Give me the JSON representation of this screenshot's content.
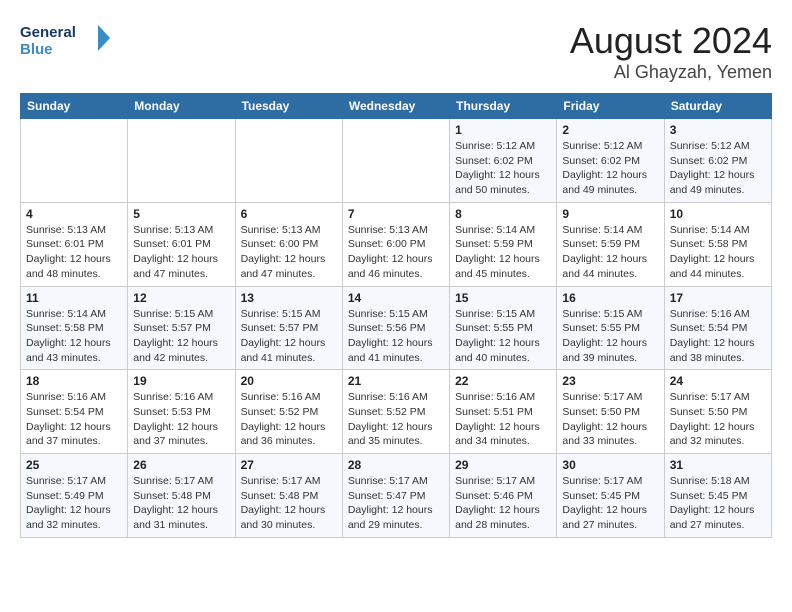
{
  "header": {
    "logo_general": "General",
    "logo_blue": "Blue",
    "month": "August 2024",
    "location": "Al Ghayzah, Yemen"
  },
  "weekdays": [
    "Sunday",
    "Monday",
    "Tuesday",
    "Wednesday",
    "Thursday",
    "Friday",
    "Saturday"
  ],
  "weeks": [
    [
      {
        "day": "",
        "info": ""
      },
      {
        "day": "",
        "info": ""
      },
      {
        "day": "",
        "info": ""
      },
      {
        "day": "",
        "info": ""
      },
      {
        "day": "1",
        "info": "Sunrise: 5:12 AM\nSunset: 6:02 PM\nDaylight: 12 hours\nand 50 minutes."
      },
      {
        "day": "2",
        "info": "Sunrise: 5:12 AM\nSunset: 6:02 PM\nDaylight: 12 hours\nand 49 minutes."
      },
      {
        "day": "3",
        "info": "Sunrise: 5:12 AM\nSunset: 6:02 PM\nDaylight: 12 hours\nand 49 minutes."
      }
    ],
    [
      {
        "day": "4",
        "info": "Sunrise: 5:13 AM\nSunset: 6:01 PM\nDaylight: 12 hours\nand 48 minutes."
      },
      {
        "day": "5",
        "info": "Sunrise: 5:13 AM\nSunset: 6:01 PM\nDaylight: 12 hours\nand 47 minutes."
      },
      {
        "day": "6",
        "info": "Sunrise: 5:13 AM\nSunset: 6:00 PM\nDaylight: 12 hours\nand 47 minutes."
      },
      {
        "day": "7",
        "info": "Sunrise: 5:13 AM\nSunset: 6:00 PM\nDaylight: 12 hours\nand 46 minutes."
      },
      {
        "day": "8",
        "info": "Sunrise: 5:14 AM\nSunset: 5:59 PM\nDaylight: 12 hours\nand 45 minutes."
      },
      {
        "day": "9",
        "info": "Sunrise: 5:14 AM\nSunset: 5:59 PM\nDaylight: 12 hours\nand 44 minutes."
      },
      {
        "day": "10",
        "info": "Sunrise: 5:14 AM\nSunset: 5:58 PM\nDaylight: 12 hours\nand 44 minutes."
      }
    ],
    [
      {
        "day": "11",
        "info": "Sunrise: 5:14 AM\nSunset: 5:58 PM\nDaylight: 12 hours\nand 43 minutes."
      },
      {
        "day": "12",
        "info": "Sunrise: 5:15 AM\nSunset: 5:57 PM\nDaylight: 12 hours\nand 42 minutes."
      },
      {
        "day": "13",
        "info": "Sunrise: 5:15 AM\nSunset: 5:57 PM\nDaylight: 12 hours\nand 41 minutes."
      },
      {
        "day": "14",
        "info": "Sunrise: 5:15 AM\nSunset: 5:56 PM\nDaylight: 12 hours\nand 41 minutes."
      },
      {
        "day": "15",
        "info": "Sunrise: 5:15 AM\nSunset: 5:55 PM\nDaylight: 12 hours\nand 40 minutes."
      },
      {
        "day": "16",
        "info": "Sunrise: 5:15 AM\nSunset: 5:55 PM\nDaylight: 12 hours\nand 39 minutes."
      },
      {
        "day": "17",
        "info": "Sunrise: 5:16 AM\nSunset: 5:54 PM\nDaylight: 12 hours\nand 38 minutes."
      }
    ],
    [
      {
        "day": "18",
        "info": "Sunrise: 5:16 AM\nSunset: 5:54 PM\nDaylight: 12 hours\nand 37 minutes."
      },
      {
        "day": "19",
        "info": "Sunrise: 5:16 AM\nSunset: 5:53 PM\nDaylight: 12 hours\nand 37 minutes."
      },
      {
        "day": "20",
        "info": "Sunrise: 5:16 AM\nSunset: 5:52 PM\nDaylight: 12 hours\nand 36 minutes."
      },
      {
        "day": "21",
        "info": "Sunrise: 5:16 AM\nSunset: 5:52 PM\nDaylight: 12 hours\nand 35 minutes."
      },
      {
        "day": "22",
        "info": "Sunrise: 5:16 AM\nSunset: 5:51 PM\nDaylight: 12 hours\nand 34 minutes."
      },
      {
        "day": "23",
        "info": "Sunrise: 5:17 AM\nSunset: 5:50 PM\nDaylight: 12 hours\nand 33 minutes."
      },
      {
        "day": "24",
        "info": "Sunrise: 5:17 AM\nSunset: 5:50 PM\nDaylight: 12 hours\nand 32 minutes."
      }
    ],
    [
      {
        "day": "25",
        "info": "Sunrise: 5:17 AM\nSunset: 5:49 PM\nDaylight: 12 hours\nand 32 minutes."
      },
      {
        "day": "26",
        "info": "Sunrise: 5:17 AM\nSunset: 5:48 PM\nDaylight: 12 hours\nand 31 minutes."
      },
      {
        "day": "27",
        "info": "Sunrise: 5:17 AM\nSunset: 5:48 PM\nDaylight: 12 hours\nand 30 minutes."
      },
      {
        "day": "28",
        "info": "Sunrise: 5:17 AM\nSunset: 5:47 PM\nDaylight: 12 hours\nand 29 minutes."
      },
      {
        "day": "29",
        "info": "Sunrise: 5:17 AM\nSunset: 5:46 PM\nDaylight: 12 hours\nand 28 minutes."
      },
      {
        "day": "30",
        "info": "Sunrise: 5:17 AM\nSunset: 5:45 PM\nDaylight: 12 hours\nand 27 minutes."
      },
      {
        "day": "31",
        "info": "Sunrise: 5:18 AM\nSunset: 5:45 PM\nDaylight: 12 hours\nand 27 minutes."
      }
    ]
  ]
}
